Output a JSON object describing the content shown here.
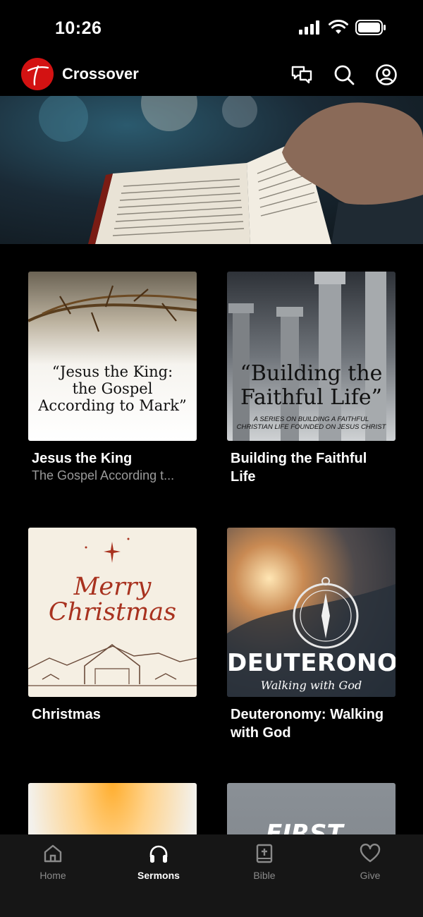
{
  "status": {
    "time": "10:26"
  },
  "header": {
    "app_name": "Crossover"
  },
  "sermons": [
    {
      "title": "Jesus the King",
      "subtitle": "The Gospel According t...",
      "art_lines": [
        "“Jesus the King:",
        "the Gospel",
        "According to Mark”"
      ]
    },
    {
      "title": "Building the Faithful Life",
      "art_lines": [
        "“Building the",
        "Faithful Life”"
      ],
      "art_small": [
        "A SERIES ON BUILDING A FAITHFUL",
        "CHRISTIAN LIFE FOUNDED ON JESUS CHRIST"
      ]
    },
    {
      "title": "Christmas",
      "art_lines": [
        "Merry",
        "Christmas"
      ]
    },
    {
      "title": "Deuteronomy: Walking with God",
      "art_lines": [
        "DEUTERONOMY"
      ],
      "art_script": "Walking with God"
    },
    {
      "title": ""
    },
    {
      "title": "",
      "art_lines": [
        "FIRST"
      ]
    }
  ],
  "tabs": [
    {
      "label": "Home",
      "icon": "home-icon"
    },
    {
      "label": "Sermons",
      "icon": "headphones-icon",
      "active": true
    },
    {
      "label": "Bible",
      "icon": "bible-icon"
    },
    {
      "label": "Give",
      "icon": "heart-icon"
    }
  ],
  "colors": {
    "accent": "#d31212",
    "background": "#000000",
    "tab_bar": "#161616",
    "inactive": "#8a8a8a"
  }
}
